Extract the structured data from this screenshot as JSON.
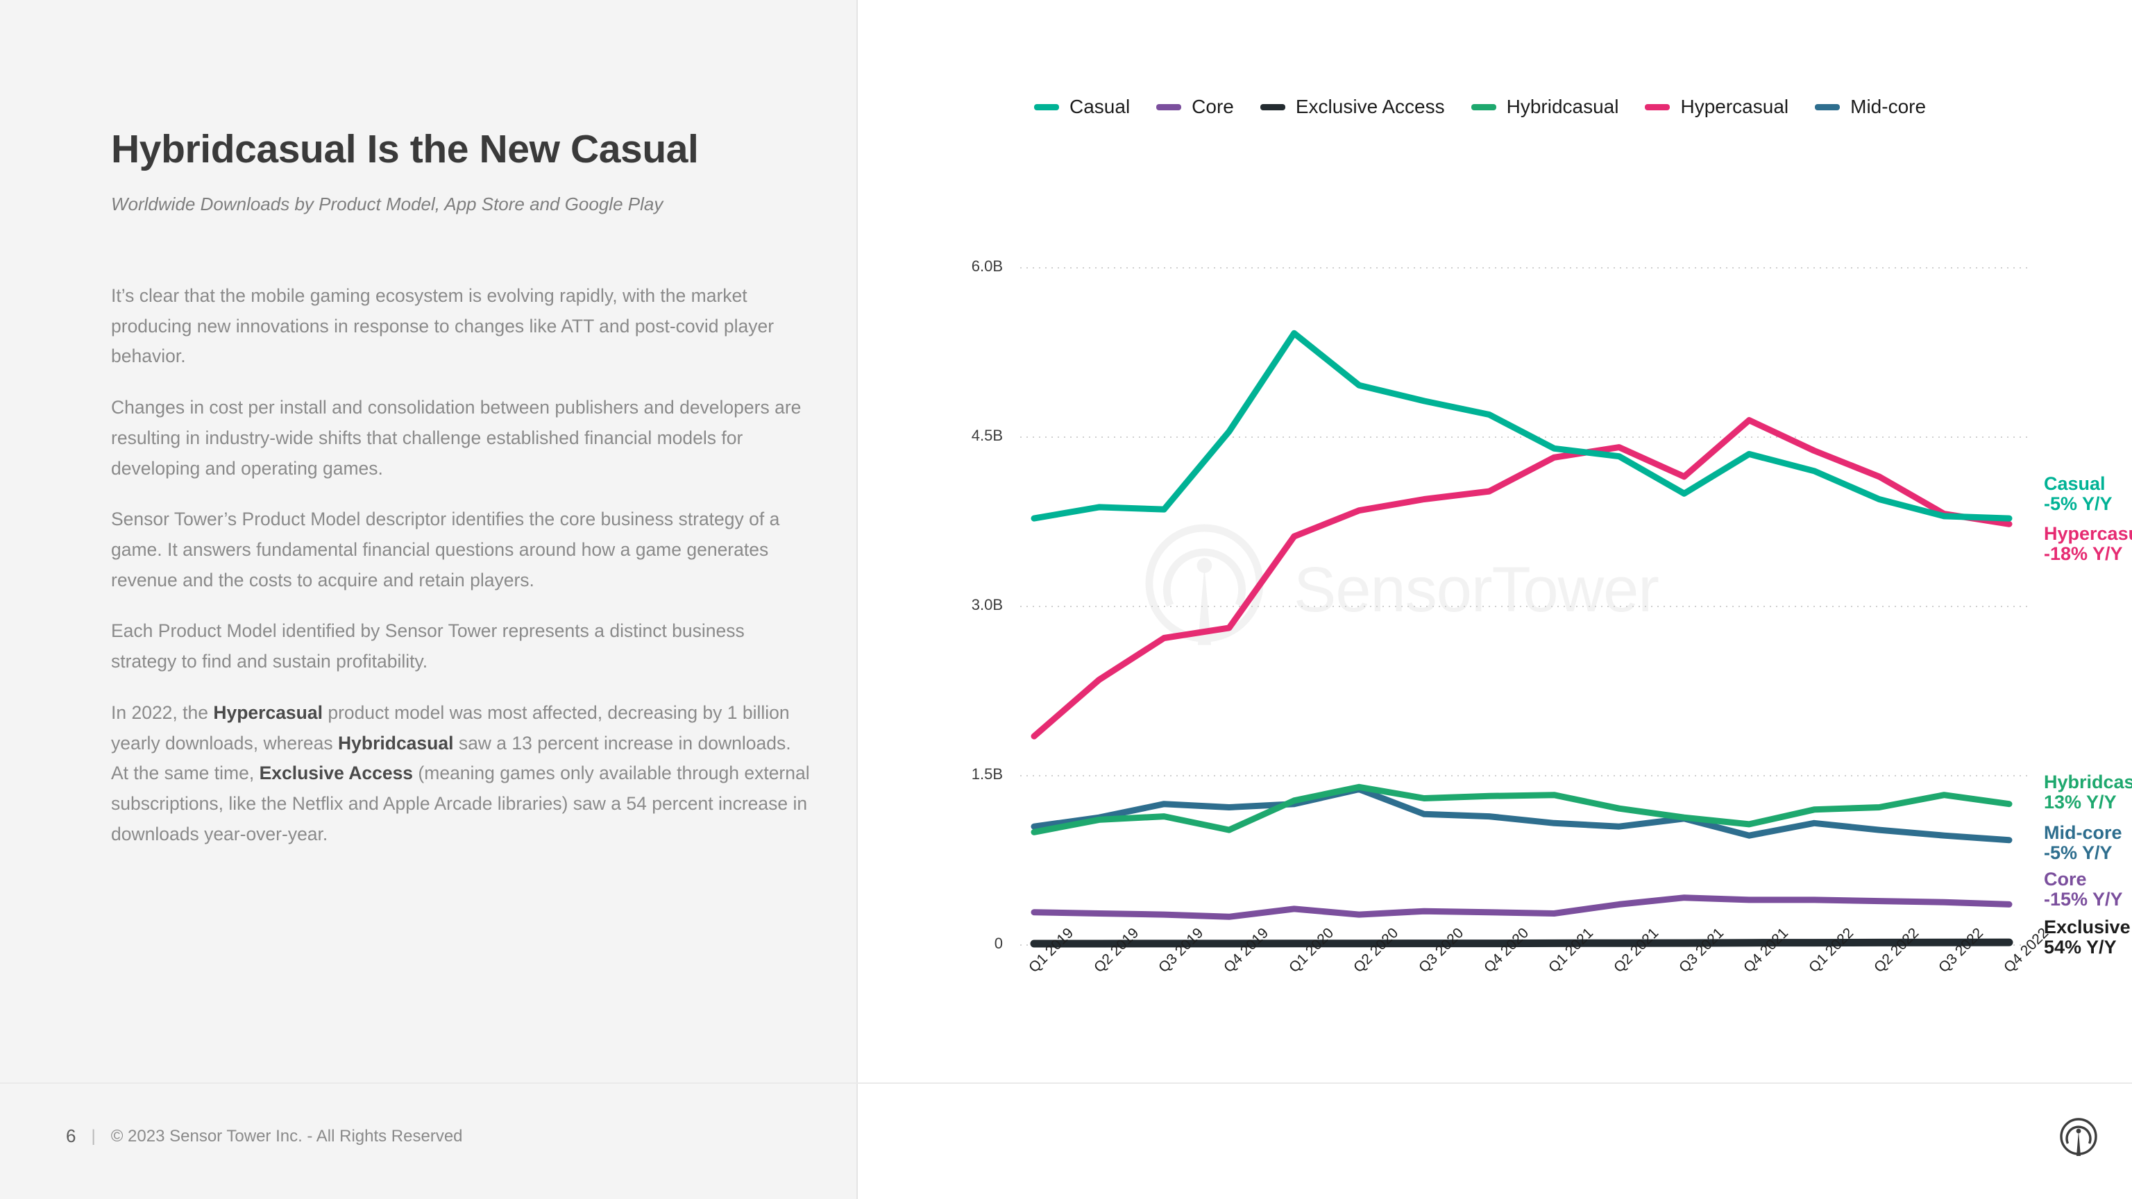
{
  "slide": {
    "title": "Hybridcasual Is the New Casual",
    "subtitle": "Worldwide Downloads by Product Model, App Store and Google Play",
    "paragraphs": [
      "It’s clear that the mobile gaming ecosystem is evolving rapidly, with the market producing new innovations in response to changes like ATT and post-covid player behavior.",
      "Changes in cost per install and consolidation between publishers and developers are resulting in industry-wide shifts that challenge established financial models for developing and operating games.",
      "Sensor Tower’s Product Model descriptor identifies the core business strategy of a game. It answers fundamental financial questions around how a game generates revenue and the costs to acquire and retain players.",
      "Each Product Model identified by Sensor Tower represents a distinct business strategy to find and sustain profitability."
    ],
    "final_paragraph": {
      "segments": [
        {
          "text": "In 2022, the ",
          "bold": false
        },
        {
          "text": "Hypercasual",
          "bold": true
        },
        {
          "text": " product model was most affected, decreasing by 1 billion yearly downloads, whereas ",
          "bold": false
        },
        {
          "text": "Hybridcasual",
          "bold": true
        },
        {
          "text": " saw a 13 percent increase in downloads. At the same time, ",
          "bold": false
        },
        {
          "text": "Exclusive Access",
          "bold": true
        },
        {
          "text": " (meaning games only available through external subscriptions, like the Netflix and Apple Arcade libraries) saw a 54 percent increase in downloads year-over-year.",
          "bold": false
        }
      ]
    }
  },
  "footer": {
    "page_number": "6",
    "separator": "|",
    "copyright": "© 2023 Sensor Tower Inc. - All Rights Reserved",
    "logo_icon": "sensor-tower-logo-icon"
  },
  "watermark": {
    "text": "SensorTower",
    "logo_icon": "sensor-tower-watermark-icon"
  },
  "chart_data": {
    "type": "line",
    "title": "",
    "xlabel": "",
    "ylabel": "",
    "ylim": [
      0,
      6000000000
    ],
    "ytick_labels": [
      "0",
      "1.5B",
      "3.0B",
      "4.5B",
      "6.0B"
    ],
    "ytick_values": [
      0,
      1500000000,
      3000000000,
      4500000000,
      6000000000
    ],
    "grid": true,
    "legend_position": "top",
    "categories": [
      "Q1 2019",
      "Q2 2019",
      "Q3 2019",
      "Q4 2019",
      "Q1 2020",
      "Q2 2020",
      "Q3 2020",
      "Q4 2020",
      "Q1 2021",
      "Q2 2021",
      "Q3 2021",
      "Q4 2021",
      "Q1 2022",
      "Q2 2022",
      "Q3 2022",
      "Q4 2022"
    ],
    "series": [
      {
        "name": "Casual",
        "color": "#00b295",
        "values": [
          3.78,
          3.88,
          3.86,
          4.55,
          5.42,
          4.96,
          4.82,
          4.7,
          4.4,
          4.33,
          4.0,
          4.35,
          4.2,
          3.95,
          3.8,
          3.78
        ],
        "unit": "B"
      },
      {
        "name": "Core",
        "color": "#7b4f9d",
        "values": [
          0.29,
          0.28,
          0.27,
          0.25,
          0.32,
          0.27,
          0.3,
          0.29,
          0.28,
          0.36,
          0.42,
          0.4,
          0.4,
          0.39,
          0.38,
          0.36
        ],
        "unit": "B"
      },
      {
        "name": "Exclusive Access",
        "color": "#232b30",
        "values": [
          0.012,
          0.012,
          0.013,
          0.013,
          0.014,
          0.014,
          0.015,
          0.015,
          0.016,
          0.017,
          0.018,
          0.02,
          0.021,
          0.022,
          0.023,
          0.024
        ],
        "unit": "B"
      },
      {
        "name": "Hybridcasual",
        "color": "#1ea86e",
        "values": [
          1.0,
          1.11,
          1.14,
          1.02,
          1.28,
          1.4,
          1.3,
          1.32,
          1.33,
          1.21,
          1.13,
          1.07,
          1.2,
          1.22,
          1.33,
          1.25
        ],
        "unit": "B"
      },
      {
        "name": "Hypercasual",
        "color": "#e62b72",
        "values": [
          1.85,
          2.35,
          2.72,
          2.81,
          3.62,
          3.85,
          3.95,
          4.02,
          4.32,
          4.41,
          4.15,
          4.65,
          4.38,
          4.15,
          3.82,
          3.73
        ],
        "unit": "B"
      },
      {
        "name": "Mid-core",
        "color": "#2e6e8e",
        "values": [
          1.05,
          1.13,
          1.25,
          1.22,
          1.25,
          1.38,
          1.16,
          1.14,
          1.08,
          1.05,
          1.12,
          0.97,
          1.08,
          1.02,
          0.97,
          0.93
        ],
        "unit": "B"
      }
    ],
    "annotations": [
      {
        "name": "Casual",
        "value": "-5% Y/Y",
        "color": "#00b295",
        "series": "Casual"
      },
      {
        "name": "Hypercasual",
        "value": "-18% Y/Y",
        "color": "#e62b72",
        "series": "Hypercasual"
      },
      {
        "name": "Hybridcasual",
        "value": "13% Y/Y",
        "color": "#1ea86e",
        "series": "Hybridcasual"
      },
      {
        "name": "Mid-core",
        "value": "-5% Y/Y",
        "color": "#2e6e8e",
        "series": "Mid-core"
      },
      {
        "name": "Core",
        "value": "-15% Y/Y",
        "color": "#7b4f9d",
        "series": "Core"
      },
      {
        "name": "Exclusive Access",
        "value": "54% Y/Y",
        "color": "#1c1c1c",
        "series": "Exclusive Access"
      }
    ]
  }
}
